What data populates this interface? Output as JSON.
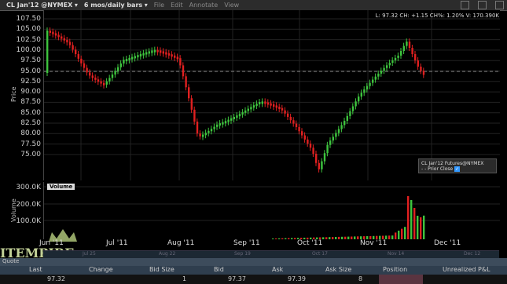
{
  "title": {
    "symbol": "CL Jan'12 @NYMEX",
    "period": "6 mos/daily bars",
    "menus": [
      "File",
      "Edit",
      "Annotate",
      "View"
    ]
  },
  "status_line": "L: 97.32 CH: +1.15 CH%: 1.20% V: 170.390K",
  "price_axis": {
    "label": "Price",
    "ticks": [
      "107.50",
      "105.00",
      "102.50",
      "100.00",
      "97.50",
      "95.00",
      "92.50",
      "90.00",
      "87.50",
      "85.00",
      "82.50",
      "80.00",
      "77.50",
      "75.00"
    ]
  },
  "volume_axis": {
    "label": "Volume",
    "ticks": [
      "300.0K",
      "200.0K",
      "100.0K"
    ]
  },
  "volume_title": "Volume",
  "legend": {
    "title": "CL Jan'12 Futures@NYMEX",
    "item": "Prior Close"
  },
  "x_labels": [
    "Jun '11",
    "Jul '11",
    "Aug '11",
    "Sep '11",
    "Oct '11",
    "Nov '11",
    "Dec '11"
  ],
  "navigator_labels": [
    "Jul 25",
    "Aug 22",
    "Sep 19",
    "Oct 17",
    "Nov 14",
    "Dec 12"
  ],
  "watermark": "ITEMPIRE.com",
  "quote": {
    "tab": "Quote",
    "columns": [
      "Last",
      "Change",
      "Bid Size",
      "Bid",
      "Ask",
      "Ask Size",
      "Position",
      "Unrealized P&L"
    ],
    "values": {
      "last": "97.32",
      "change": "",
      "bid_size": "1",
      "bid": "97.37",
      "ask": "97.39",
      "ask_size": "8",
      "position": "",
      "unrealized": ""
    }
  },
  "colors": {
    "up": "#3ec43e",
    "down": "#e02020",
    "prior_close": "#888888"
  }
}
